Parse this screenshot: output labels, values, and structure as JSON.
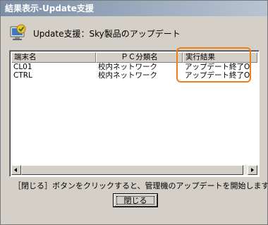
{
  "window": {
    "title": "結果表示-Update支援"
  },
  "header": {
    "icon": "app-update-icon",
    "text": "Update支援：Sky製品のアップデート"
  },
  "list": {
    "columns": [
      "端末名",
      "ＰＣ分類名",
      "実行結果"
    ],
    "rows": [
      [
        "CL01",
        "校内ネットワーク",
        "アップデート終了O"
      ],
      [
        "CTRL",
        "校内ネットワーク",
        "アップデート終了O"
      ]
    ]
  },
  "footer": {
    "info": "［閉じる］ボタンをクリックすると、管理機のアップデートを開始します。",
    "close_label": "閉じる"
  },
  "colors": {
    "highlight": "#f07f1a",
    "title_bar": "#7a8ea6"
  }
}
